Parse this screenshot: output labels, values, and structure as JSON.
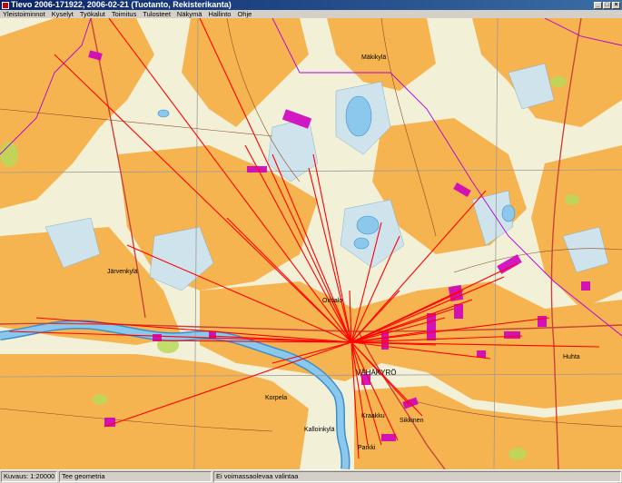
{
  "window": {
    "title": "Tievo 2006-171922, 2006-02-21 (Tuotanto, Rekisterikanta)",
    "icon": "app-icon"
  },
  "menu": [
    "Yleistoiminnot",
    "Kyselyt",
    "Työkalut",
    "Toimitus",
    "Tulosteet",
    "Näkymä",
    "Hallinto",
    "Ohje"
  ],
  "map": {
    "labels": {
      "center_town": "VÄHÄKYRÖ",
      "town_west": "Järvenkylä",
      "town_center_n": "Orisalo",
      "town_south": "Sikkinen",
      "town_se": "Kalloinkylä",
      "place_s1": "Korpela",
      "place_s2": "Kraakku",
      "place_s3": "Parkki",
      "place_n1": "Mäkikylä",
      "place_e1": "Huhta"
    },
    "colors": {
      "field": "#f6b450",
      "forest": "#f3f0d8",
      "bog": "#cfe3ec",
      "water": "#8cc8ec",
      "river": "#4aa6e0",
      "grid": "#9a9a9a",
      "boundary": "#b000d8",
      "parcel": "#d000c0",
      "ray": "#ff0000",
      "green": "#b8d85a"
    }
  },
  "status": {
    "scale": "Kuvaus: 1:20000",
    "mode": "Tee geometria",
    "selection": "Ei voimassaolevaa valintaa"
  }
}
